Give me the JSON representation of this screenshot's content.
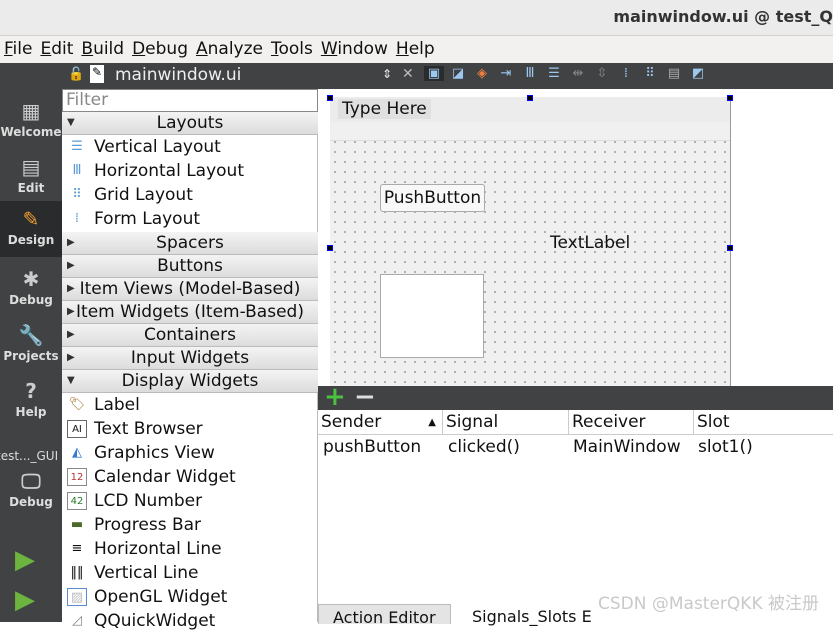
{
  "window": {
    "title": "mainwindow.ui @ test_Q"
  },
  "menu": [
    "File",
    "Edit",
    "Build",
    "Debug",
    "Analyze",
    "Tools",
    "Window",
    "Help"
  ],
  "modes": [
    {
      "label": "Welcome",
      "icon": "grid-icon"
    },
    {
      "label": "Edit",
      "icon": "document-icon"
    },
    {
      "label": "Design",
      "icon": "pencil-icon"
    },
    {
      "label": "Debug",
      "icon": "bug-icon"
    },
    {
      "label": "Projects",
      "icon": "wrench-icon"
    },
    {
      "label": "Help",
      "icon": "help-icon"
    }
  ],
  "kit": {
    "project": "test..._GUI",
    "config": "Debug"
  },
  "document": {
    "filename": "mainwindow.ui"
  },
  "widgetbox": {
    "filter_placeholder": "Filter",
    "layouts": "Layouts",
    "layout_items": [
      "Vertical Layout",
      "Horizontal Layout",
      "Grid Layout",
      "Form Layout"
    ],
    "categories": [
      "Spacers",
      "Buttons",
      "Item Views (Model-Based)",
      "Item Widgets (Item-Based)",
      "Containers",
      "Input Widgets"
    ],
    "display": "Display Widgets",
    "display_items": [
      "Label",
      "Text Browser",
      "Graphics View",
      "Calendar Widget",
      "LCD Number",
      "Progress Bar",
      "Horizontal Line",
      "Vertical Line",
      "OpenGL Widget",
      "QQuickWidget"
    ]
  },
  "form": {
    "menu_placeholder": "Type Here",
    "button": "PushButton",
    "label": "TextLabel"
  },
  "signals": {
    "headers": [
      "Sender",
      "Signal",
      "Receiver",
      "Slot"
    ],
    "rows": [
      [
        "pushButton",
        "clicked()",
        "MainWindow",
        "slot1()"
      ]
    ],
    "add": "+",
    "remove": "−"
  },
  "tabs": [
    "Action Editor",
    "Signals_Slots E"
  ],
  "watermark": "CSDN @MasterQKK 被注册"
}
